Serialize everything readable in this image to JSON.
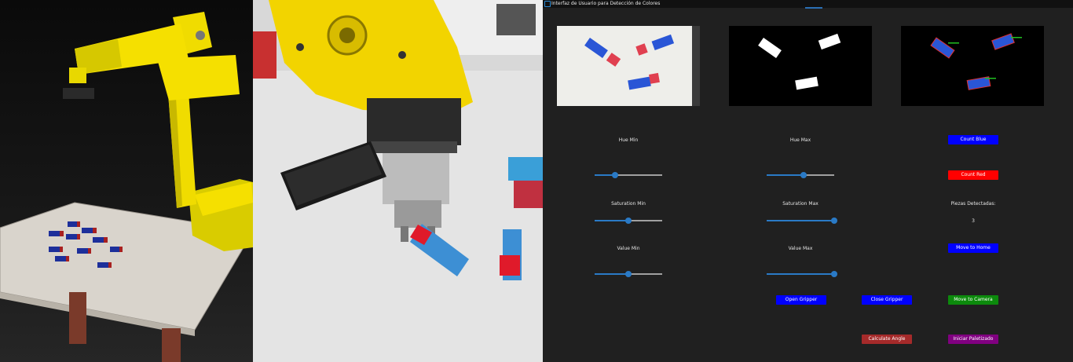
{
  "window": {
    "title": "Interfaz de Usuario para Detección de Colores"
  },
  "cameras": {
    "feed": "camera-feed",
    "mask": "color-mask",
    "detected": "detected-overlay"
  },
  "sliders": {
    "hue_min": {
      "label": "Hue Min",
      "value": 0.3
    },
    "hue_max": {
      "label": "Hue Max",
      "value": 0.55
    },
    "sat_min": {
      "label": "Saturation Min",
      "value": 0.5
    },
    "sat_max": {
      "label": "Saturation Max",
      "value": 1.0
    },
    "val_min": {
      "label": "Value Min",
      "value": 0.5
    },
    "val_max": {
      "label": "Value Max",
      "value": 1.0
    }
  },
  "buttons": {
    "count_blue": "Count Blue",
    "count_red": "Count Red",
    "move_home": "Move to Home",
    "open_gripper": "Open Gripper",
    "close_gripper": "Close Gripper",
    "move_camera": "Move to Camera",
    "calculate_angle": "Calculate Angle",
    "iniciar_paletizado": "Iniciar Paletizado"
  },
  "counter": {
    "label": "Piezas Detectadas:",
    "value": "3"
  },
  "colors": {
    "blue_button": "#0000ff",
    "red_button": "#ff0000",
    "green_button": "#0c8a0c",
    "brown_button": "#a52a2a",
    "purple_button": "#800080",
    "slider_accent": "#2a7ac6",
    "robot_yellow": "#f5e000"
  }
}
